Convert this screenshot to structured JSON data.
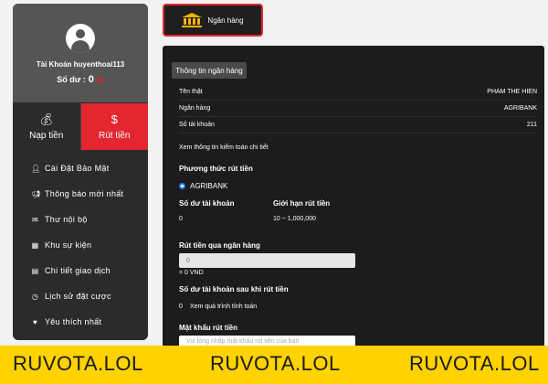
{
  "sidebar": {
    "account_label": "Tài Khoản huyenthoai113",
    "balance_label": "Số dư :",
    "balance_value": "0",
    "currency_icon": "coin-icon",
    "deposit_label": "Nạp tiền",
    "withdraw_label": "Rút tiền",
    "menu": [
      {
        "label": "Cài Đặt Bảo Mật",
        "icon": "user-shield-icon"
      },
      {
        "label": "Thông báo mới nhất",
        "icon": "megaphone-icon"
      },
      {
        "label": "Thư nội bộ",
        "icon": "mail-icon"
      },
      {
        "label": "Khu sự kiện",
        "icon": "calendar-icon"
      },
      {
        "label": "Chi tiết giao dịch",
        "icon": "clipboard-icon"
      },
      {
        "label": "Lịch sử đặt cược",
        "icon": "history-icon"
      },
      {
        "label": "Yêu thích nhất",
        "icon": "heart-icon"
      }
    ]
  },
  "tab": {
    "label": "Ngân hàng",
    "icon": "bank-icon"
  },
  "panel": {
    "info_button": "Thông tin ngân hàng",
    "rows": [
      {
        "label": "Tên thật",
        "value": "PHAM THE HIEN"
      },
      {
        "label": "Ngân hàng",
        "value": "AGRIBANK"
      },
      {
        "label": "Số tài khoản",
        "value": "211"
      }
    ],
    "detail_link": "Xem thông tin kiểm toán chi tiết",
    "method_title": "Phương thức rút tiền",
    "method_option": "AGRIBANK",
    "balance_title": "Số dư tài khoản",
    "balance_value": "0",
    "limit_title": "Giới hạn rút tiền",
    "limit_value": "10 ~ 1,000,000",
    "withdraw_title": "Rút tiền qua ngân hàng",
    "withdraw_input_value": "0",
    "withdraw_vnd": "= 0 VND",
    "after_title": "Số dư tài khoản sau khi rút tiền",
    "after_value": "0",
    "after_link": "Xem quá trình tính toán",
    "password_title": "Mật khẩu rút tiền",
    "password_placeholder": "Vui lòng nhập mật khẩu rút tiền của bạn"
  },
  "watermark": [
    "RUVOTA.LOL",
    "RUVOTA.LOL",
    "RUVOTA.LOL"
  ],
  "colors": {
    "accent": "#e3262f",
    "banner": "#ffd200",
    "gold": "#f4b400",
    "panel": "#1c1c1c"
  }
}
